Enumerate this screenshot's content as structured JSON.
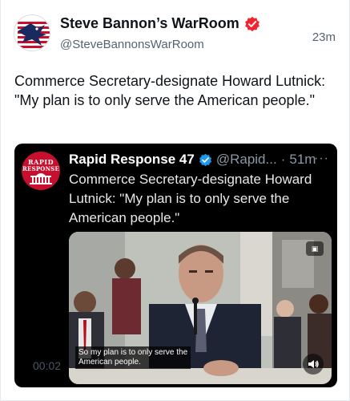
{
  "post": {
    "display_name": "Steve Bannon’s WarRoom",
    "handle": "@SteveBannonsWarRoom",
    "time": "23m",
    "text": "Commerce Secretary-designate Howard Lutnick: \"My plan is to only serve the American people.\"",
    "avatar_icon": "eagle-flag-logo-icon",
    "verified_icon": "verified-badge-icon",
    "verified_color": "#f4212e"
  },
  "quote": {
    "display_name": "Rapid Response 47",
    "handle": "@Rapid...",
    "separator": "·",
    "time": "51m",
    "more": "···",
    "text": "Commerce Secretary-designate Howard Lutnick: \"My plan is to only serve the American people.\"",
    "avatar_logo_line1": "RAPID",
    "avatar_logo_line2": "RESPONSE",
    "avatar_color": "#c8102e",
    "verified_color": "#1d9bf0",
    "video": {
      "caption_line1": "So my plan is to only serve the",
      "caption_line2": "American people.",
      "timecode": "00:02",
      "badge": "▣",
      "volume_icon": "volume-icon"
    }
  }
}
